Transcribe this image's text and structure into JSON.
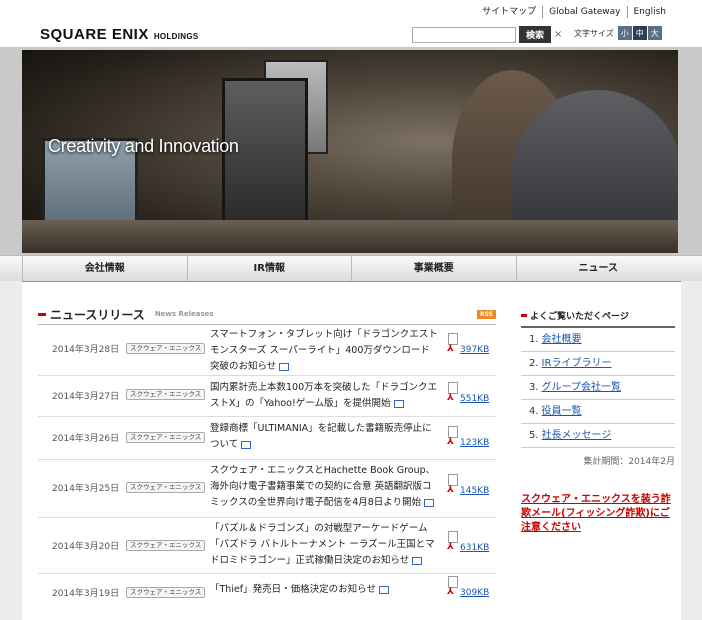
{
  "top_links": [
    "サイトマップ",
    "Global Gateway",
    "English"
  ],
  "logo": {
    "main": "SQUARE ENIX",
    "sub": "HOLDINGS"
  },
  "search": {
    "placeholder": "",
    "button": "検索",
    "clear": "×"
  },
  "font_size": {
    "label": "文字サイズ",
    "small": "小",
    "medium": "中",
    "large": "大"
  },
  "hero": {
    "tagline": "Creativity and Innovation"
  },
  "nav": [
    "会社情報",
    "IR情報",
    "事業概要",
    "ニュース"
  ],
  "news": {
    "title": "ニュースリリース",
    "subtitle": "News Releases",
    "rss": "RSS",
    "items": [
      {
        "date": "2014年3月28日",
        "company": "スクウェア・エニックス",
        "text": "スマートフォン・タブレット向け「ドラゴンクエストモンスターズ スーパーライト」400万ダウンロード突破のお知らせ",
        "size": "397KB"
      },
      {
        "date": "2014年3月27日",
        "company": "スクウェア・エニックス",
        "text": "国内累計売上本数100万本を突破した「ドラゴンクエストX」の「Yahoo!ゲーム版」を提供開始",
        "size": "551KB"
      },
      {
        "date": "2014年3月26日",
        "company": "スクウェア・エニックス",
        "text": "登録商標「ULTIMANIA」を記載した書籍販売停止について",
        "size": "123KB"
      },
      {
        "date": "2014年3月25日",
        "company": "スクウェア・エニックス",
        "text": "スクウェア・エニックスとHachette Book Group、海外向け電子書籍事業での契約に合意 英語翻訳版コミックスの全世界向け電子配信を4月8日より開始",
        "size": "145KB"
      },
      {
        "date": "2014年3月20日",
        "company": "スクウェア・エニックス",
        "text": "「パズル＆ドラゴンズ」の対戦型アーケードゲーム「パズドラ バトルトーナメント ーラズール王国とマドロミドラゴンー」正式稼働日決定のお知らせ",
        "size": "631KB"
      },
      {
        "date": "2014年3月19日",
        "company": "スクウェア・エニックス",
        "text": "「Thief」発売日・価格決定のお知らせ",
        "size": "309KB"
      }
    ]
  },
  "popular": {
    "title": "よくご覧いただくページ",
    "items": [
      {
        "num": "1.",
        "label": "会社概要"
      },
      {
        "num": "2.",
        "label": "IRライブラリー"
      },
      {
        "num": "3.",
        "label": "グループ会社一覧"
      },
      {
        "num": "4.",
        "label": "役員一覧"
      },
      {
        "num": "5.",
        "label": "社長メッセージ"
      }
    ],
    "period": "集計期間：2014年2月"
  },
  "alert": "スクウェア・エニックスを装う詐欺メール(フィッシング詐欺)にご注意ください",
  "colors": {
    "accent": "#cc0000",
    "link": "#1a55b3",
    "rss": "#f08a24"
  }
}
